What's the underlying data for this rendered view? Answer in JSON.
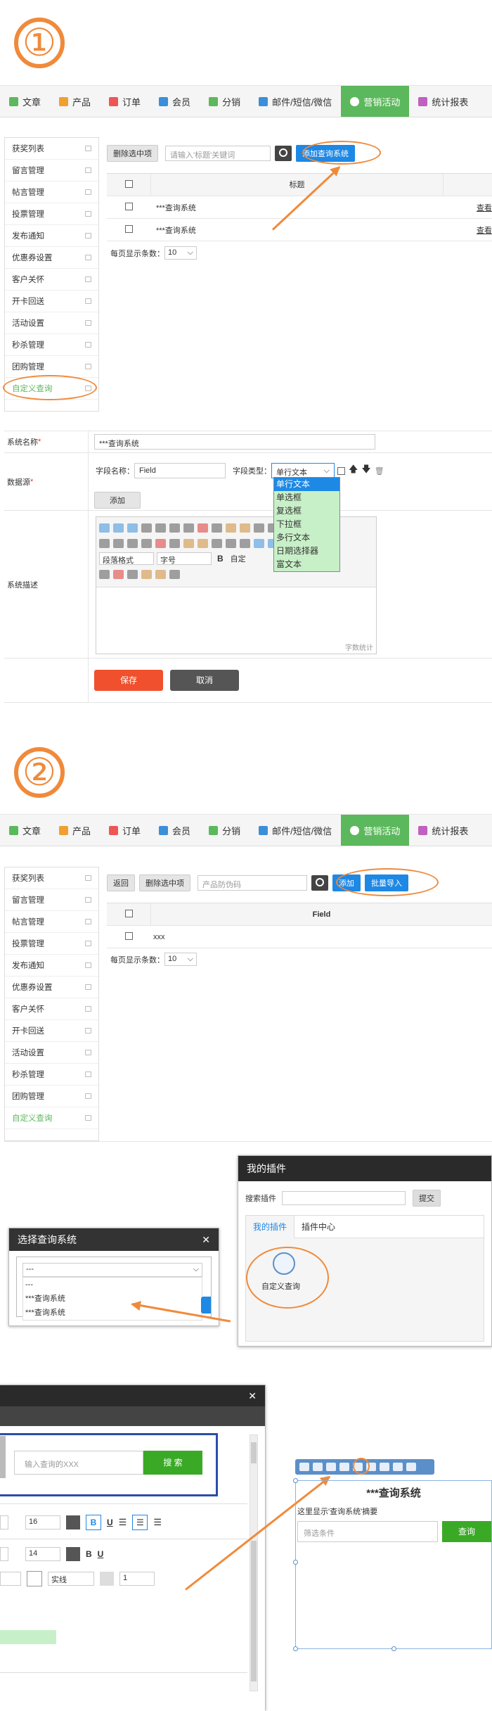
{
  "step1": "①",
  "step2": "②",
  "nav": [
    {
      "label": "文章",
      "color": "#5cb85c"
    },
    {
      "label": "产品",
      "color": "#f0a030"
    },
    {
      "label": "订单",
      "color": "#e55"
    },
    {
      "label": "会员",
      "color": "#3b8fd8"
    },
    {
      "label": "分销",
      "color": "#5cb85c"
    },
    {
      "label": "邮件/短信/微信",
      "color": "#3b8fd8"
    },
    {
      "label": "营销活动",
      "color": "#ffffff",
      "active": true
    },
    {
      "label": "统计报表",
      "color": "#c060c0"
    }
  ],
  "sidebar": [
    "获奖列表",
    "留言管理",
    "帖言管理",
    "投票管理",
    "发布通知",
    "优惠券设置",
    "客户关怀",
    "开卡回送",
    "活动设置",
    "秒杀管理",
    "团购管理",
    "自定义查询"
  ],
  "list1": {
    "delete_btn": "删除选中项",
    "search_placeholder": "请输入'标题'关键词",
    "add_btn": "添加查询系统",
    "col_title": "标题",
    "rows": [
      {
        "title": "***查询系统",
        "action": "查看"
      },
      {
        "title": "***查询系统",
        "action": "查看"
      }
    ],
    "per_page_label": "每页显示条数：",
    "per_page": "10"
  },
  "form": {
    "name_label": "系统名称",
    "name_value": "***查询系统",
    "source_label": "数据源",
    "field_name_label": "字段名称：",
    "field_name_value": "Field",
    "field_type_label": "字段类型：",
    "field_type_value": "单行文本",
    "field_types": [
      "单行文本",
      "单选框",
      "复选框",
      "下拉框",
      "多行文本",
      "日期选择器",
      "富文本"
    ],
    "add_btn": "添加",
    "desc_label": "系统描述",
    "para_format": "段落格式",
    "font_size": "字号",
    "custom": "自定",
    "word_count": "字数统计",
    "save_btn": "保存",
    "cancel_btn": "取消"
  },
  "list2": {
    "back_btn": "返回",
    "delete_btn": "删除选中项",
    "search_placeholder": "产品防伪码",
    "add_btn": "添加",
    "import_btn": "批量导入",
    "col_field": "Field",
    "row": "xxx",
    "per_page_label": "每页显示条数：",
    "per_page": "10"
  },
  "plugins": {
    "title": "我的插件",
    "search_label": "搜索插件",
    "submit_btn": "提交",
    "tab_mine": "我的插件",
    "tab_center": "插件中心",
    "plugin_name": "自定义查询"
  },
  "select_dialog": {
    "title": "选择查询系统",
    "selected": "---",
    "options": [
      "---",
      "***查询系统",
      "***查询系统"
    ]
  },
  "editor": {
    "search_placeholder": "输入查询的XXX",
    "search_btn": "搜 索",
    "size1": "16",
    "size2": "14",
    "line_style": "实线",
    "line_width": "1"
  },
  "widget": {
    "title": "***查询系统",
    "summary": "这里显示'查询系统'摘要",
    "filter_placeholder": "筛选条件",
    "query_btn": "查询"
  }
}
